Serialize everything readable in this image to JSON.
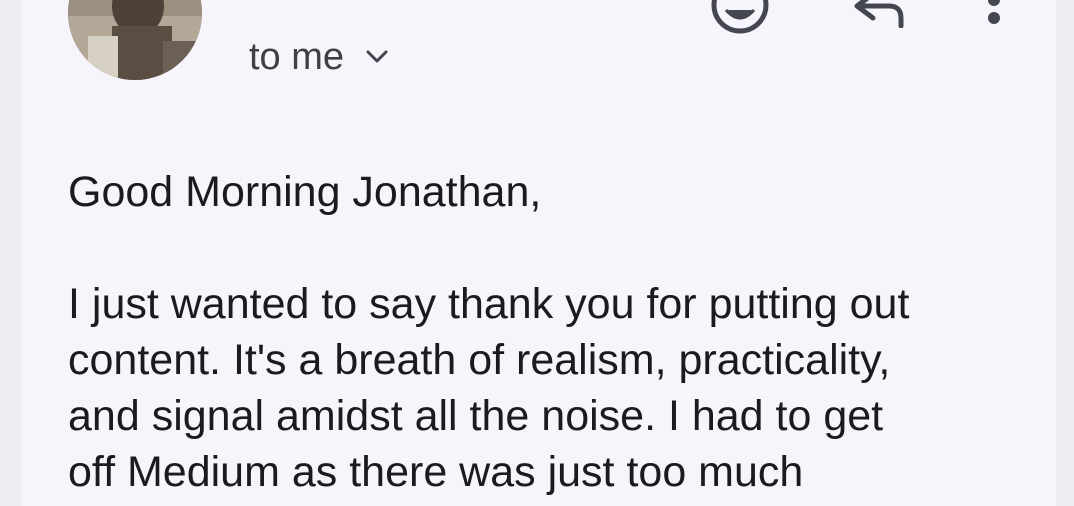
{
  "header": {
    "recipient_label": "to me",
    "icons": {
      "avatar": "sender-avatar",
      "expand": "chevron-down-icon",
      "emoji": "emoji-reaction-icon",
      "reply": "reply-icon",
      "more": "more-vert-icon"
    }
  },
  "message": {
    "greeting": "Good Morning Jonathan,",
    "lines": [
      "I just wanted to say thank you for putting out",
      "content. It's a breath of realism, practicality,",
      "and signal amidst all the noise. I had to get",
      "off Medium as there was just too much"
    ]
  },
  "colors": {
    "background": "#f7f5fc",
    "text": "#1b1b1f",
    "secondary_text": "#3f3f45",
    "icon": "#44474f"
  }
}
